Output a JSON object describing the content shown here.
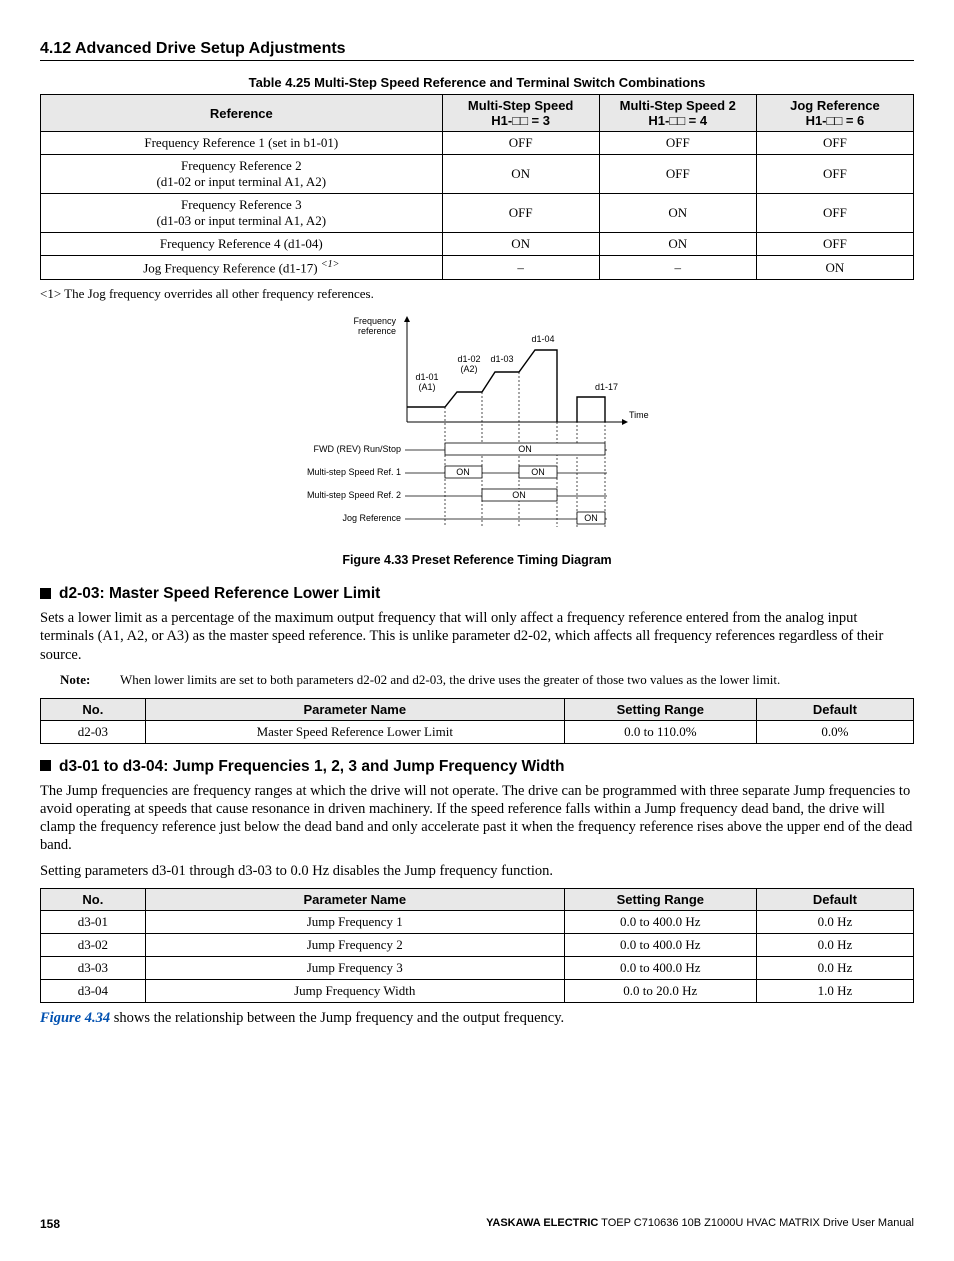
{
  "section_header": "4.12 Advanced Drive Setup Adjustments",
  "table425": {
    "title": "Table 4.25  Multi-Step Speed Reference and Terminal Switch Combinations",
    "headers": {
      "c0": "Reference",
      "c1a": "Multi-Step Speed",
      "c1b": "H1-□□ = 3",
      "c2a": "Multi-Step Speed 2",
      "c2b": "H1-□□ = 4",
      "c3a": "Jog Reference",
      "c3b": "H1-□□ = 6"
    },
    "rows": [
      {
        "ref": "Frequency Reference 1 (set in b1-01)",
        "sub": "",
        "c1": "OFF",
        "c2": "OFF",
        "c3": "OFF"
      },
      {
        "ref": "Frequency Reference 2",
        "sub": "(d1-02 or input terminal A1, A2)",
        "c1": "ON",
        "c2": "OFF",
        "c3": "OFF"
      },
      {
        "ref": "Frequency Reference 3",
        "sub": "(d1-03 or input terminal A1, A2)",
        "c1": "OFF",
        "c2": "ON",
        "c3": "OFF"
      },
      {
        "ref": "Frequency Reference 4 (d1-04)",
        "sub": "",
        "c1": "ON",
        "c2": "ON",
        "c3": "OFF"
      },
      {
        "ref": "Jog Frequency Reference (d1-17)",
        "sub": "",
        "sup": "<1>",
        "c1": "–",
        "c2": "–",
        "c3": "ON"
      }
    ]
  },
  "footnote1": "<1>   The Jog frequency overrides all other frequency references.",
  "figure433": {
    "caption": "Figure 4.33  Preset Reference Timing Diagram",
    "labels": {
      "freq_ref": "Frequency\nreference",
      "d101": "d1-01",
      "a1": "(A1)",
      "d102": "d1-02",
      "a2": "(A2)",
      "d103": "d1-03",
      "d104": "d1-04",
      "d117": "d1-17",
      "time": "Time",
      "row1": "FWD (REV) Run/Stop",
      "row2": "Multi-step Speed Ref. 1",
      "row3": "Multi-step Speed Ref. 2",
      "row4": "Jog Reference",
      "on": "ON"
    }
  },
  "d203": {
    "heading": "d2-03: Master Speed Reference Lower Limit",
    "para": "Sets a lower limit as a percentage of the maximum output frequency that will only affect a frequency reference entered from the analog input terminals (A1, A2, or A3) as the master speed reference. This is unlike parameter d2-02, which affects all frequency references regardless of their source.",
    "note_label": "Note:",
    "note_text": "When lower limits are set to both parameters d2-02 and d2-03, the drive uses the greater of those two values as the lower limit.",
    "table": {
      "h0": "No.",
      "h1": "Parameter Name",
      "h2": "Setting Range",
      "h3": "Default",
      "row": {
        "no": "d2-03",
        "name": "Master Speed Reference Lower Limit",
        "range": "0.0 to 110.0%",
        "def": "0.0%"
      }
    }
  },
  "d3": {
    "heading": "d3-01 to d3-04: Jump Frequencies 1, 2, 3 and Jump Frequency Width",
    "para1": "The Jump frequencies are frequency ranges at which the drive will not operate. The drive can be programmed with three separate Jump frequencies to avoid operating at speeds that cause resonance in driven machinery. If the speed reference falls within a Jump frequency dead band, the drive will clamp the frequency reference just below the dead band and only accelerate past it when the frequency reference rises above the upper end of the dead band.",
    "para2": "Setting parameters d3-01 through d3-03 to 0.0 Hz disables the Jump frequency function.",
    "table": {
      "h0": "No.",
      "h1": "Parameter Name",
      "h2": "Setting Range",
      "h3": "Default",
      "rows": [
        {
          "no": "d3-01",
          "name": "Jump Frequency 1",
          "range": "0.0 to 400.0 Hz",
          "def": "0.0 Hz"
        },
        {
          "no": "d3-02",
          "name": "Jump Frequency 2",
          "range": "0.0 to 400.0 Hz",
          "def": "0.0 Hz"
        },
        {
          "no": "d3-03",
          "name": "Jump Frequency 3",
          "range": "0.0 to 400.0 Hz",
          "def": "0.0 Hz"
        },
        {
          "no": "d3-04",
          "name": "Jump Frequency Width",
          "range": "0.0 to 20.0 Hz",
          "def": "1.0 Hz"
        }
      ]
    },
    "after_link": "Figure 4.34",
    "after_text": " shows the relationship between the Jump frequency and the output frequency."
  },
  "footer": {
    "page": "158",
    "brand": "YASKAWA ELECTRIC",
    "manual": " TOEP C710636 10B Z1000U HVAC MATRIX Drive User Manual"
  }
}
